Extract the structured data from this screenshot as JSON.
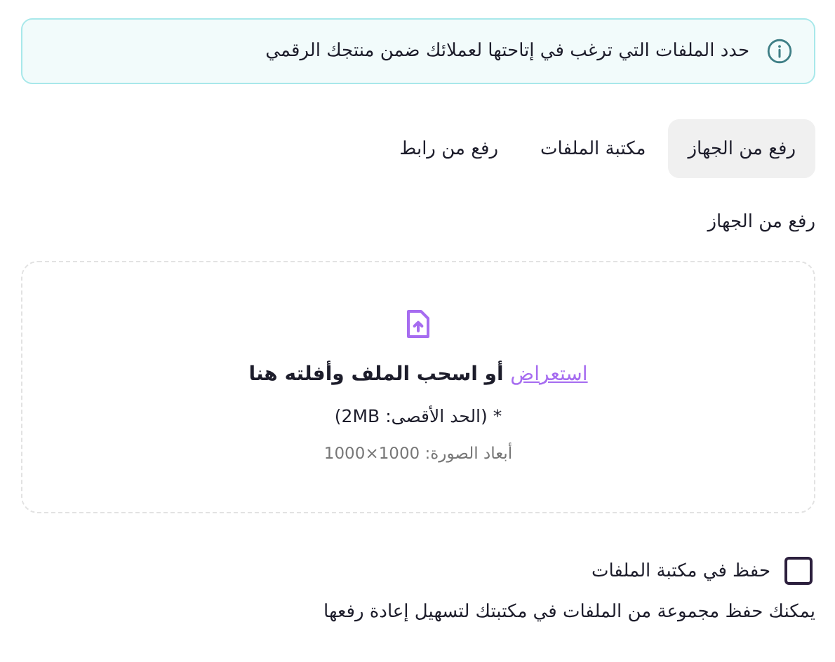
{
  "notice": {
    "text": "حدد الملفات التي ترغب في إتاحتها لعملائك ضمن منتجك الرقمي"
  },
  "tabs": [
    {
      "label": "رفع من الجهاز",
      "selected": true
    },
    {
      "label": "مكتبة الملفات",
      "selected": false
    },
    {
      "label": "رفع من رابط",
      "selected": false
    }
  ],
  "section_label": "رفع من الجهاز",
  "dropzone": {
    "link": "استعراض",
    "prompt": "أو اسحب الملف وأفلته هنا",
    "max_size": "* (الحد الأقصى: 2MB)",
    "dimensions": "أبعاد الصورة: 1000×1000"
  },
  "save_option": {
    "label": "حفظ في مكتبة الملفات",
    "checked": false,
    "help": "يمكنك حفظ مجموعة من الملفات في مكتبتك لتسهيل إعادة رفعها"
  }
}
